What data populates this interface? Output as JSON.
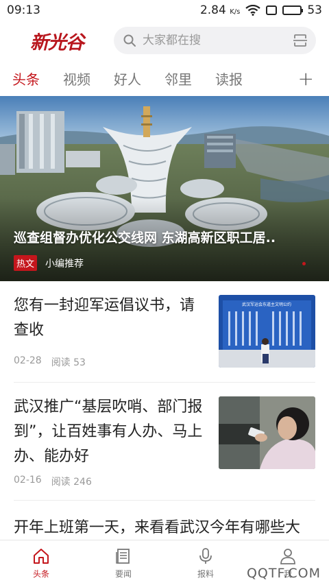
{
  "status_bar": {
    "time": "09:13",
    "speed": "2.84",
    "speed_unit": "K/s",
    "battery": "53",
    "battery_level_percent": 53
  },
  "header": {
    "logo_text": "新光谷",
    "search_placeholder": "大家都在搜"
  },
  "tabs": [
    {
      "label": "头条",
      "active": true
    },
    {
      "label": "视频",
      "active": false
    },
    {
      "label": "好人",
      "active": false
    },
    {
      "label": "邻里",
      "active": false
    },
    {
      "label": "读报",
      "active": false
    }
  ],
  "tabs_more": "+",
  "banner": {
    "title": "巡查组督办优化公交线网 东湖高新区职工居..",
    "tag": "热文",
    "source": "小编推荐"
  },
  "news": [
    {
      "title": "您有一封迎军运倡议书，请查收",
      "date": "02-28",
      "reads_label": "阅读 53",
      "thumb_title": "武汉军运会东道主文明公约"
    },
    {
      "title": "武汉推广“基层吹哨、部门报到”，让百姓事有人办、马上办、能办好",
      "date": "02-16",
      "reads_label": "阅读 246"
    },
    {
      "title": "开年上班第一天，来看看武汉今年有哪些大"
    }
  ],
  "bottom_nav": [
    {
      "label": "头条",
      "icon": "home-icon",
      "active": true
    },
    {
      "label": "要闻",
      "icon": "news-icon",
      "active": false
    },
    {
      "label": "报料",
      "icon": "microphone-icon",
      "active": false
    },
    {
      "label": "我",
      "icon": "user-icon",
      "active": false
    }
  ],
  "watermark": "QQTF.COM",
  "colors": {
    "accent": "#c4161c",
    "text": "#222222",
    "muted": "#999999"
  }
}
